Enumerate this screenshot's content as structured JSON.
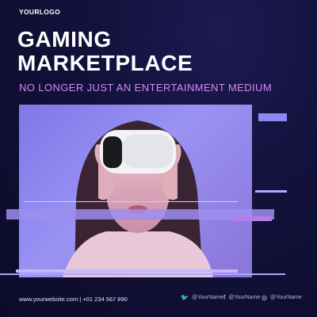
{
  "brand": {
    "logo_text": "YOURLOGO"
  },
  "headline": {
    "line1": "GAMING",
    "line2": "MARKETPLACE"
  },
  "subtitle": "NO LONGER JUST AN ENTERTAINMENT MEDIUM",
  "footer": {
    "contact": "www.yourwebsite.com | +01 234 567 890",
    "social": [
      {
        "icon": "twitter-icon",
        "handle": "@YourName"
      },
      {
        "icon": "facebook-icon",
        "handle": "@YourName"
      },
      {
        "icon": "instagram-icon",
        "handle": "@YourName"
      }
    ]
  },
  "colors": {
    "background": "#12113a",
    "accent": "#d489f2",
    "photo_tint": "#8d86ee"
  }
}
